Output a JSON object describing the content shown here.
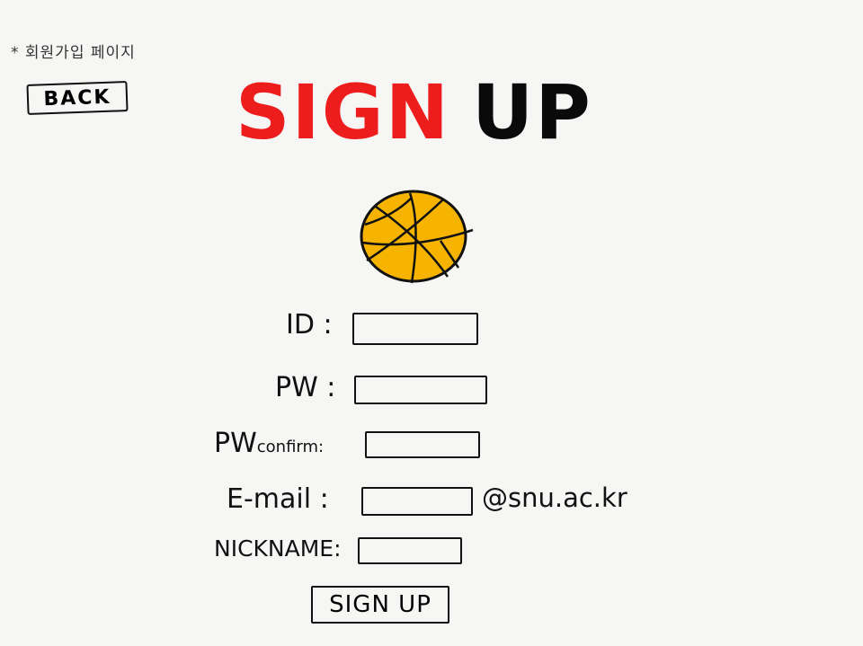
{
  "page": {
    "note": "* 회원가입 페이지",
    "back_label": "BACK",
    "title_part1": "SIGN",
    "title_part2": "UP",
    "colors": {
      "title_red": "#ee1d1d",
      "ball_orange": "#f6b400",
      "background": "#f6f6f5"
    },
    "logo_icon": "basketball-icon"
  },
  "form": {
    "id_label": "ID :",
    "pw_label": "PW :",
    "pw_confirm_label_main": "PW",
    "pw_confirm_label_small": "confirm:",
    "email_label": "E-mail :",
    "email_suffix": "@snu.ac.kr",
    "nickname_label": "NICKNAME:",
    "id_value": "",
    "pw_value": "",
    "pw_confirm_value": "",
    "email_value": "",
    "nickname_value": "",
    "submit_label": "SIGN UP"
  }
}
